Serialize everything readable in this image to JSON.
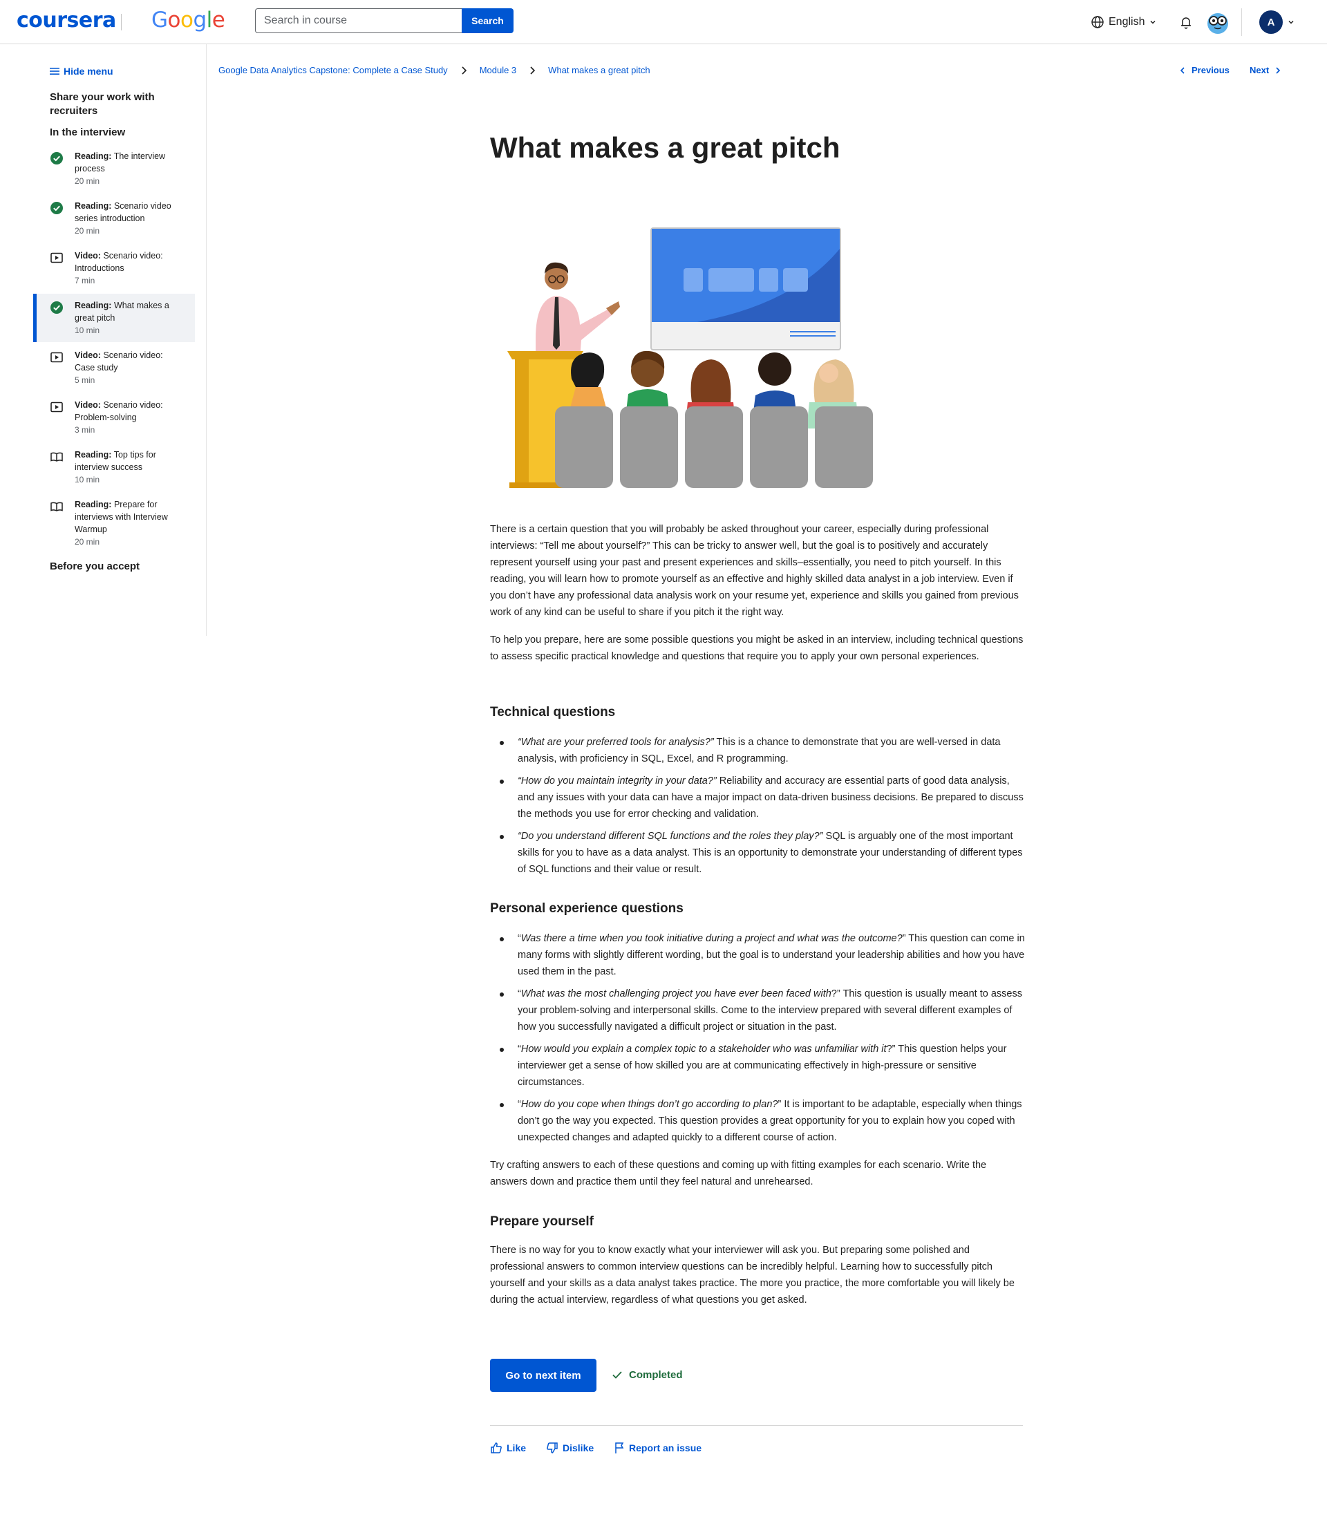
{
  "header": {
    "brand_coursera": "coursera",
    "brand_google_letters": [
      "G",
      "o",
      "o",
      "g",
      "l",
      "e"
    ],
    "search": {
      "placeholder": "Search in course",
      "button_label": "Search"
    },
    "language_label": "English",
    "avatar_initial": "A"
  },
  "sidebar": {
    "hide_menu_label": "Hide menu",
    "section_title": "Share your work with recruiters",
    "subsection_title": "In the interview",
    "items": [
      {
        "type": "Reading:",
        "title": "The interview process",
        "duration": "20 min",
        "status": "completed",
        "icon": "check-circle-icon"
      },
      {
        "type": "Reading:",
        "title": "Scenario video series introduction",
        "duration": "20 min",
        "status": "completed",
        "icon": "check-circle-icon"
      },
      {
        "type": "Video:",
        "title": "Scenario video: Introductions",
        "duration": "7 min",
        "status": "not-started",
        "icon": "play-video-icon"
      },
      {
        "type": "Reading:",
        "title": "What makes a great pitch",
        "duration": "10 min",
        "status": "completed-current",
        "icon": "check-circle-icon"
      },
      {
        "type": "Video:",
        "title": "Scenario video: Case study",
        "duration": "5 min",
        "status": "not-started",
        "icon": "play-video-icon"
      },
      {
        "type": "Video:",
        "title": "Scenario video: Problem-solving",
        "duration": "3 min",
        "status": "not-started",
        "icon": "play-video-icon"
      },
      {
        "type": "Reading:",
        "title": "Top tips for interview success",
        "duration": "10 min",
        "status": "not-started",
        "icon": "book-icon"
      },
      {
        "type": "Reading:",
        "title": "Prepare for interviews with Interview Warmup",
        "duration": "20 min",
        "status": "not-started",
        "icon": "book-icon"
      }
    ],
    "next_section_title": "Before you accept"
  },
  "breadcrumb": [
    "Google Data Analytics Capstone: Complete a Case Study",
    "Module 3",
    "What makes a great pitch"
  ],
  "nav": {
    "previous_label": "Previous",
    "next_label": "Next"
  },
  "article": {
    "title": "What makes a great pitch",
    "intro_1": "There is a certain question that you will probably be asked throughout your career, especially during professional interviews: “Tell me about yourself?” This can be tricky to answer well, but the goal is to positively and accurately represent yourself using your past and present experiences and skills–essentially, you need to pitch yourself. In this reading, you will learn how to promote yourself as an effective and highly skilled data analyst in a job interview. Even if you don’t have any professional data analysis work on your resume yet, experience and skills you gained from previous work of any kind can be useful to share if you pitch it the right way.",
    "intro_2": "To help you prepare, here are some possible questions you might be asked in an interview, including technical questions to assess specific practical knowledge and questions that require you to apply your own personal experiences.",
    "technical_heading": "Technical questions",
    "technical": [
      {
        "q": "“What are your preferred tools for analysis?”",
        "a": " This is a chance to demonstrate that you are well-versed in data analysis, with proficiency in SQL, Excel, and R programming."
      },
      {
        "q": "“How do you maintain integrity in your data?”",
        "a": " Reliability and accuracy are essential parts of good data analysis, and any issues with your data can have a major impact on data-driven business decisions. Be prepared to discuss the methods you use for error checking and validation."
      },
      {
        "q": "“Do you understand different SQL functions and the roles they play?”",
        "a": " SQL is arguably one of the most important skills for you to have as a data analyst. This is an opportunity to demonstrate your understanding of different types of SQL functions and their value or result."
      }
    ],
    "personal_heading": "Personal experience questions",
    "personal": [
      {
        "pre": "“",
        "q": "Was there a time when you took initiative during a project and what was the outcome?",
        "a": "” This question can come in many forms with slightly different wording, but the goal is to understand your leadership abilities and how you have used them in the past."
      },
      {
        "pre": "“",
        "q": "What was the most challenging project you have ever been faced with",
        "a": "?” This question is usually meant to assess your problem-solving and interpersonal skills. Come to the interview prepared with several different examples of how you successfully navigated a difficult project or situation in the past."
      },
      {
        "pre": "“",
        "q": "How would you explain a complex topic to a stakeholder who was unfamiliar with it",
        "a": "?” This question helps your interviewer get a sense of how skilled you are at communicating effectively in high-pressure or sensitive circumstances."
      },
      {
        "pre": "“",
        "q": "How do you cope when things don’t go according to plan?",
        "a": "” It is important to be adaptable, especially when things don’t go the way you expected. This question provides a great opportunity for you to explain how you coped with unexpected changes and adapted quickly to a different course of action."
      }
    ],
    "practice_text": "Try crafting answers to each of these questions and coming up with fitting examples for each scenario. Write the answers down and practice them until they feel natural and unrehearsed.",
    "prepare_heading": "Prepare yourself",
    "prepare_text": "There is no way for you to know exactly what your interviewer will ask you. But preparing some polished and professional answers to common interview questions can be incredibly helpful. Learning how to successfully pitch yourself and your skills as a data analyst takes practice. The more you practice, the more comfortable you will likely be during the actual interview, regardless of what questions you get asked."
  },
  "footer": {
    "next_item_label": "Go to next item",
    "completed_label": "Completed",
    "like_label": "Like",
    "dislike_label": "Dislike",
    "report_label": "Report an issue"
  },
  "colors": {
    "brand_blue": "#0056d2",
    "success_green": "#1e6b3b",
    "active_bg": "#f0f2f5"
  }
}
